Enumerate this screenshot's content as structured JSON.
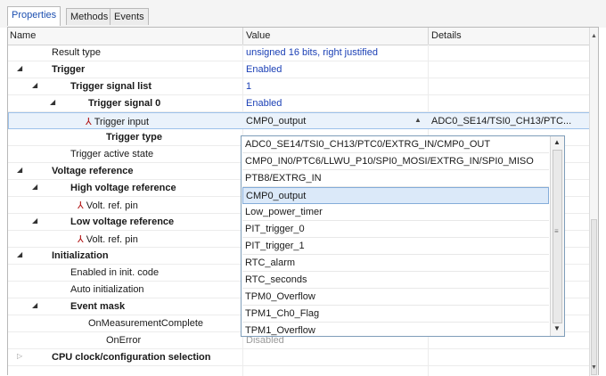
{
  "tabs": [
    {
      "label": "Properties",
      "active": true
    },
    {
      "label": "Methods",
      "active": false
    },
    {
      "label": "Events",
      "active": false
    }
  ],
  "columns": {
    "name": "Name",
    "value": "Value",
    "details": "Details"
  },
  "rows": [
    {
      "name": "Result type",
      "value": "unsigned 16 bits, right justified",
      "details": ""
    },
    {
      "name": "Trigger",
      "value": "Enabled",
      "details": ""
    },
    {
      "name": "Trigger signal list",
      "value": "1",
      "details": ""
    },
    {
      "name": "Trigger signal 0",
      "value": "Enabled",
      "details": ""
    },
    {
      "name": "Trigger input",
      "value": "CMP0_output",
      "details": "ADC0_SE14/TSI0_CH13/PTC..."
    },
    {
      "name": "Trigger type",
      "value": "",
      "details": ""
    },
    {
      "name": "Trigger active state",
      "value": "",
      "details": ""
    },
    {
      "name": "Voltage reference",
      "value": "",
      "details": ""
    },
    {
      "name": "High voltage reference",
      "value": "",
      "details": ""
    },
    {
      "name": "Volt. ref. pin",
      "value": "",
      "details": ""
    },
    {
      "name": "Low voltage reference",
      "value": "",
      "details": ""
    },
    {
      "name": "Volt. ref. pin",
      "value": "",
      "details": ""
    },
    {
      "name": "Initialization",
      "value": "",
      "details": ""
    },
    {
      "name": "Enabled in init. code",
      "value": "",
      "details": ""
    },
    {
      "name": "Auto initialization",
      "value": "",
      "details": ""
    },
    {
      "name": "Event mask",
      "value": "",
      "details": ""
    },
    {
      "name": "OnMeasurementComplete",
      "value": "",
      "details": ""
    },
    {
      "name": "OnError",
      "value": "Disabled",
      "details": ""
    },
    {
      "name": "CPU clock/configuration selection",
      "value": "",
      "details": ""
    }
  ],
  "dropdown": {
    "options": [
      "ADC0_SE14/TSI0_CH13/PTC0/EXTRG_IN/CMP0_OUT",
      "CMP0_IN0/PTC6/LLWU_P10/SPI0_MOSI/EXTRG_IN/SPI0_MISO",
      "PTB8/EXTRG_IN",
      "CMP0_output",
      "Low_power_timer",
      "PIT_trigger_0",
      "PIT_trigger_1",
      "RTC_alarm",
      "RTC_seconds",
      "TPM0_Overflow",
      "TPM1_Ch0_Flag",
      "TPM1_Overflow"
    ],
    "selected": "CMP0_output"
  },
  "colors": {
    "accent_blue": "#1a3fb5",
    "pin_red": "#b01010",
    "selection": "#dbe9f9"
  }
}
